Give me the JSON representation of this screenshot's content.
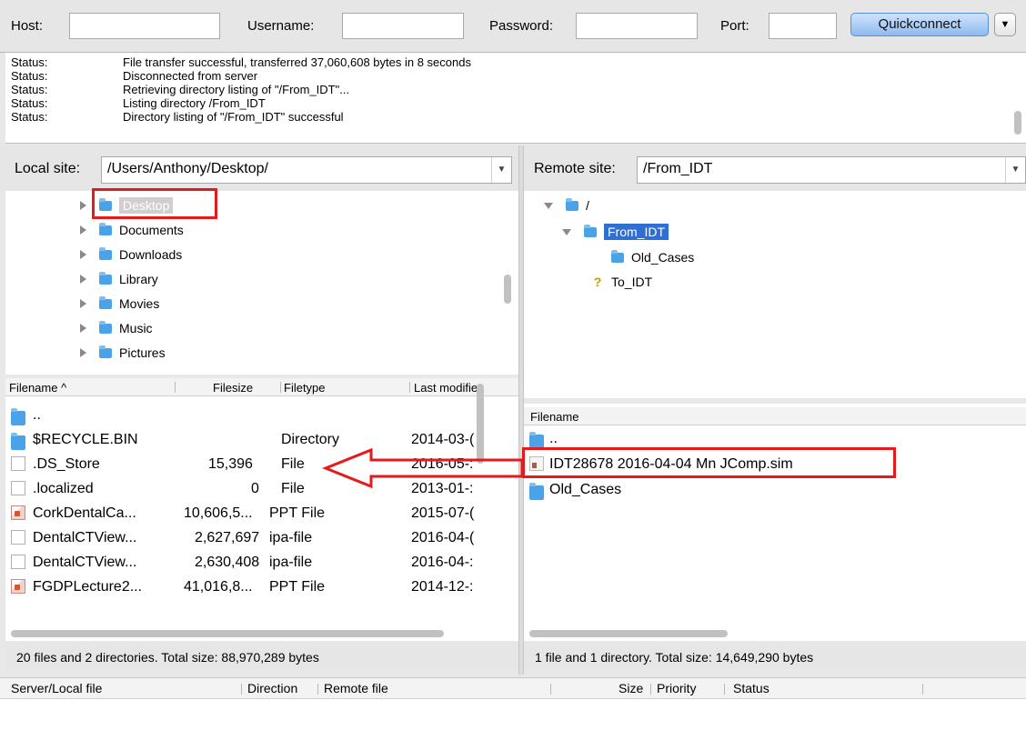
{
  "toolbar": {
    "host_label": "Host:",
    "host_value": "",
    "username_label": "Username:",
    "username_value": "",
    "password_label": "Password:",
    "password_value": "",
    "port_label": "Port:",
    "port_value": "",
    "quickconnect_label": "Quickconnect",
    "dropdown_icon": "chevron-down-icon"
  },
  "log": [
    {
      "key": "Status:",
      "msg": "File transfer successful, transferred 37,060,608 bytes in 8 seconds"
    },
    {
      "key": "Status:",
      "msg": "Disconnected from server"
    },
    {
      "key": "Status:",
      "msg": "Retrieving directory listing of \"/From_IDT\"..."
    },
    {
      "key": "Status:",
      "msg": "Listing directory /From_IDT"
    },
    {
      "key": "Status:",
      "msg": "Directory listing of \"/From_IDT\" successful"
    }
  ],
  "local": {
    "site_label": "Local site:",
    "site_path": "/Users/Anthony/Desktop/",
    "tree": [
      "Desktop",
      "Documents",
      "Downloads",
      "Library",
      "Movies",
      "Music",
      "Pictures"
    ],
    "columns": {
      "filename": "Filename",
      "sort_indicator": "^",
      "filesize": "Filesize",
      "filetype": "Filetype",
      "modified": "Last modifie"
    },
    "files": [
      {
        "name": "..",
        "size": "",
        "type": "",
        "date": "",
        "icon": "folder"
      },
      {
        "name": "$RECYCLE.BIN",
        "size": "",
        "type": "Directory",
        "date": "2014-03-(",
        "icon": "folder"
      },
      {
        "name": ".DS_Store",
        "size": "15,396",
        "type": "File",
        "date": "2016-05-:",
        "icon": "doc"
      },
      {
        "name": ".localized",
        "size": "0",
        "type": "File",
        "date": "2013-01-:",
        "icon": "doc"
      },
      {
        "name": "CorkDentalCa...",
        "size": "10,606,5...",
        "type": "PPT File",
        "date": "2015-07-(",
        "icon": "ppt"
      },
      {
        "name": "DentalCTView...",
        "size": "2,627,697",
        "type": "ipa-file",
        "date": "2016-04-(",
        "icon": "doc"
      },
      {
        "name": "DentalCTView...",
        "size": "2,630,408",
        "type": "ipa-file",
        "date": "2016-04-:",
        "icon": "doc"
      },
      {
        "name": "FGDPLecture2...",
        "size": "41,016,8...",
        "type": "PPT File",
        "date": "2014-12-:",
        "icon": "ppt"
      }
    ],
    "status": "20 files and 2 directories. Total size: 88,970,289 bytes"
  },
  "remote": {
    "site_label": "Remote site:",
    "site_path": "/From_IDT",
    "tree": {
      "root": "/",
      "selected": "From_IDT",
      "child": "Old_Cases",
      "unknown": "To_IDT",
      "unknown_mark": "?"
    },
    "columns": {
      "filename": "Filename"
    },
    "files": [
      {
        "name": "..",
        "icon": "folder"
      },
      {
        "name": "IDT28678 2016-04-04 Mn JComp.sim",
        "icon": "sim"
      },
      {
        "name": "Old_Cases",
        "icon": "folder"
      }
    ],
    "status": "1 file and 1 directory. Total size: 14,649,290 bytes"
  },
  "queue": {
    "columns": {
      "server_local": "Server/Local file",
      "direction": "Direction",
      "remote_file": "Remote file",
      "size": "Size",
      "priority": "Priority",
      "status": "Status"
    }
  },
  "annotation_color": "#e31b1b",
  "selection_color": "#2f6fd2"
}
